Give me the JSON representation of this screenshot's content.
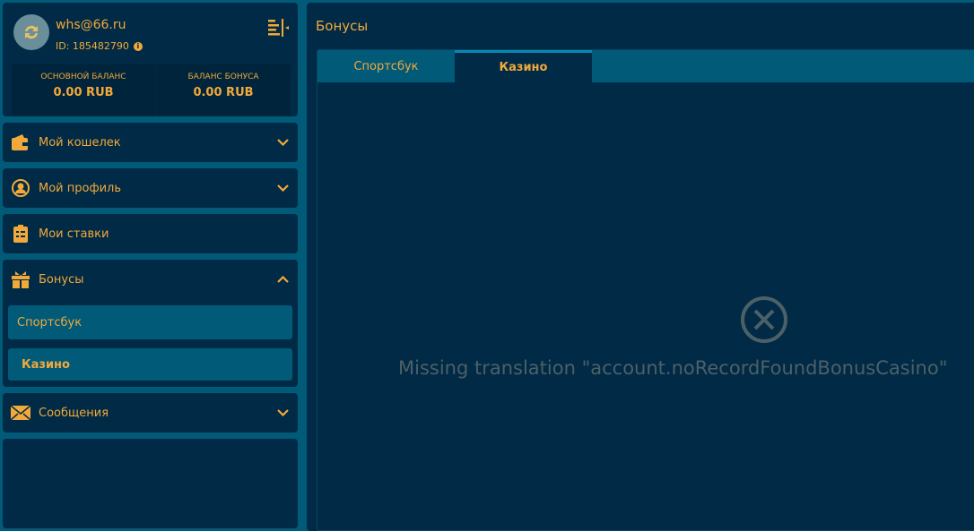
{
  "user": {
    "email": "whs@66.ru",
    "id": "ID: 185482790"
  },
  "balances": [
    {
      "label": "ОСНОВНОЙ БАЛАНС",
      "value": "0.00 RUB"
    },
    {
      "label": "БАЛАНС БОНУСА",
      "value": "0.00 RUB"
    }
  ],
  "menu": {
    "wallet": "Мой кошелек",
    "profile": "Мой профиль",
    "bets": "Мои ставки",
    "bonuses": "Бонусы",
    "bonus_sub": [
      "Спортсбук",
      "Казино"
    ],
    "messages": "Сообщения"
  },
  "main": {
    "title": "Бонусы",
    "tabs": [
      "Спортсбук",
      "Казино"
    ],
    "empty_text": "Missing translation \"account.noRecordFoundBonusCasino\""
  },
  "colors": {
    "accent": "#f2a93b",
    "panel": "#002a45",
    "background": "#005a78"
  }
}
